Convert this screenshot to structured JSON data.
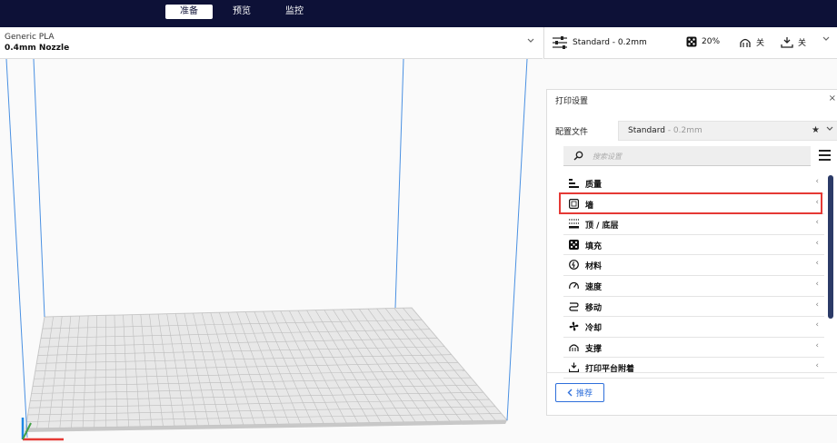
{
  "top_tabs": [
    {
      "label": "准备",
      "active": true
    },
    {
      "label": "预览",
      "active": false
    },
    {
      "label": "监控",
      "active": false
    }
  ],
  "material": {
    "name": "Generic PLA",
    "nozzle": "0.4mm Nozzle"
  },
  "settings_bar": {
    "profile": "Standard - 0.2mm",
    "infill": "20%",
    "support": "关",
    "adhesion": "关"
  },
  "print_settings": {
    "title": "打印设置",
    "profile_label": "配置文件",
    "profile_name": "Standard",
    "profile_suffix": " - 0.2mm",
    "search_placeholder": "搜索设置",
    "categories": [
      {
        "label": "质量",
        "icon": "quality-icon"
      },
      {
        "label": "墙",
        "icon": "shell-icon"
      },
      {
        "label": "顶 / 底层",
        "icon": "top-bottom-icon"
      },
      {
        "label": "填充",
        "icon": "infill-icon"
      },
      {
        "label": "材料",
        "icon": "material-icon"
      },
      {
        "label": "速度",
        "icon": "speed-icon"
      },
      {
        "label": "移动",
        "icon": "travel-icon"
      },
      {
        "label": "冷却",
        "icon": "cooling-icon"
      },
      {
        "label": "支撑",
        "icon": "support-icon"
      },
      {
        "label": "打印平台附着",
        "icon": "adhesion-icon"
      }
    ],
    "recommend_label": "推荐",
    "highlighted_category": "墙"
  },
  "colors": {
    "header": "#0d1137",
    "accent": "#2e6fdb",
    "highlight": "#e53935",
    "build_volume": "#4a90e2"
  }
}
